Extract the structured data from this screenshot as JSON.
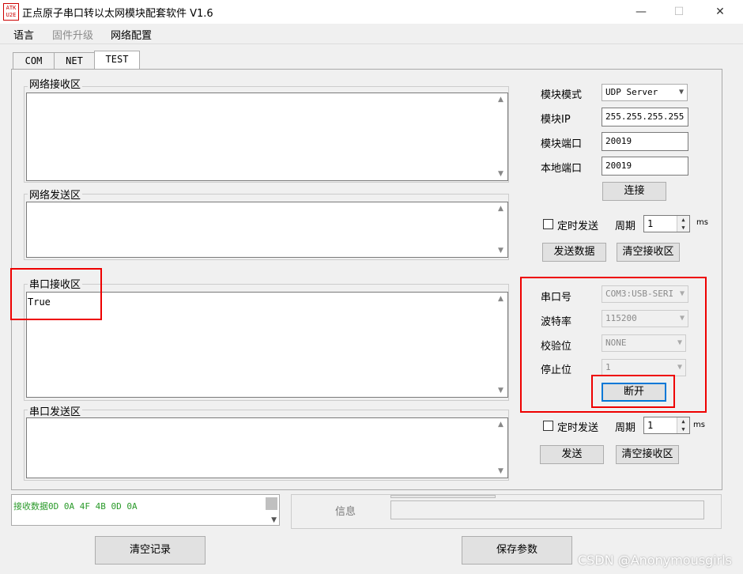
{
  "window": {
    "title": "正点原子串口转以太网模块配套软件 V1.6",
    "logo_text": "ATK U2E",
    "minimize": "—",
    "maximize": "☐",
    "close": "✕"
  },
  "menu": [
    "语言",
    "固件升级",
    "网络配置"
  ],
  "tabs": [
    "COM",
    "NET",
    "TEST"
  ],
  "left": {
    "net_recv_label": "网络接收区",
    "net_send_label": "网络发送区",
    "serial_recv_label": "串口接收区",
    "serial_recv_content": "True",
    "serial_send_label": "串口发送区"
  },
  "net_config": {
    "mode_label": "模块模式",
    "mode_value": "UDP Server",
    "ip_label": "模块IP",
    "ip_value": "255.255.255.255",
    "port_label": "模块端口",
    "port_value": "20019",
    "local_port_label": "本地端口",
    "local_port_value": "20019",
    "connect_button": "连接",
    "timer_send_label": "定时发送",
    "period_label": "周期",
    "period_value": "1",
    "ms_label": "ms",
    "send_data_button": "发送数据",
    "clear_recv_button": "清空接收区"
  },
  "serial_config": {
    "port_label": "串口号",
    "port_value": "COM3:USB-SERI",
    "baud_label": "波特率",
    "baud_value": "115200",
    "parity_label": "校验位",
    "parity_value": "NONE",
    "stop_label": "停止位",
    "stop_value": "1",
    "disconnect_button": "断开",
    "timer_send_label": "定时发送",
    "period_label": "周期",
    "period_value": "1",
    "ms_label": "ms",
    "send_button": "发送",
    "clear_recv_button": "清空接收区"
  },
  "status": {
    "log_text": "接收数据0D 0A 4F 4B 0D 0A",
    "info_label": "信息"
  },
  "bottom": {
    "clear_log_button": "清空记录",
    "save_params_button": "保存参数"
  },
  "watermark": "CSDN @Anonymousgirls",
  "colors": {
    "highlight_red": "#e00000",
    "log_green": "#2a9a2a",
    "focus_blue": "#0078d7"
  }
}
